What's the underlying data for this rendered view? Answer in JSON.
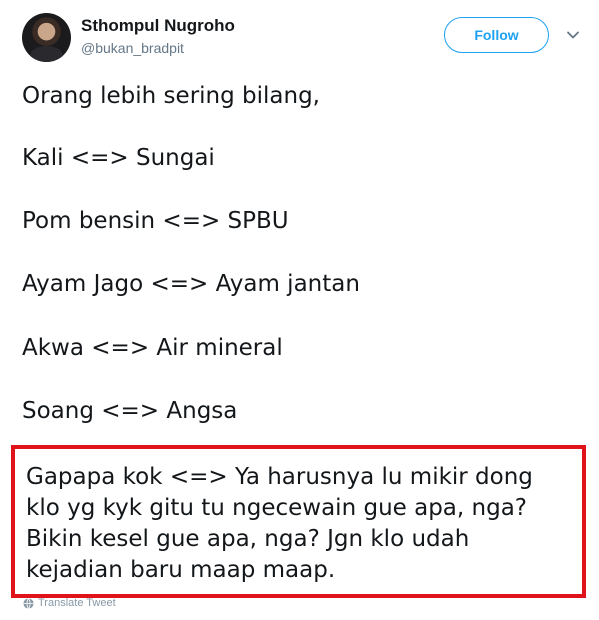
{
  "user": {
    "name": "Sthompul Nugroho",
    "handle": "@bukan_bradpit"
  },
  "actions": {
    "follow_label": "Follow"
  },
  "tweet": {
    "lines": [
      "Orang lebih sering bilang,",
      "Kali <=> Sungai",
      "Pom bensin <=> SPBU",
      "Ayam Jago <=> Ayam jantan",
      "Akwa <=> Air mineral",
      "Soang <=> Angsa"
    ],
    "highlighted_lines": [
      "Gapapa kok <=> Ya harusnya lu mikir dong",
      "klo yg kyk gitu tu ngecewain gue apa, nga?",
      "Bikin kesel gue apa, nga? Jgn klo udah",
      "kejadian baru maap maap."
    ],
    "translate_label": "Translate Tweet"
  },
  "colors": {
    "accent": "#1da1f2",
    "highlight_border": "#e0131b",
    "text": "#14171a",
    "secondary_text": "#657786"
  },
  "icons": {
    "menu": "chevron-down-icon",
    "translate": "globe-icon"
  }
}
